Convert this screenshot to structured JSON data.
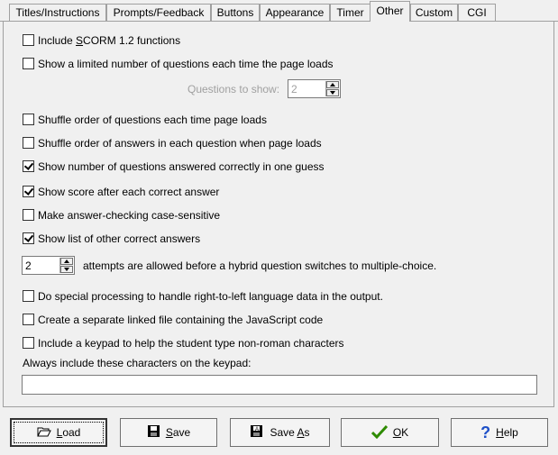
{
  "tabs": [
    {
      "label": "Titles/Instructions",
      "active": false
    },
    {
      "label": "Prompts/Feedback",
      "active": false
    },
    {
      "label": "Buttons",
      "active": false
    },
    {
      "label": "Appearance",
      "active": false
    },
    {
      "label": "Timer",
      "active": false
    },
    {
      "label": "Other",
      "active": true
    },
    {
      "label": "Custom",
      "active": false
    },
    {
      "label": "CGI",
      "active": false
    }
  ],
  "options": {
    "scorm_pre": "Include ",
    "scorm_key": "S",
    "scorm_post": "CORM 1.2 functions",
    "scorm_checked": false,
    "limited": "Show a limited number of questions each time the page loads",
    "limited_checked": false,
    "questions_to_show_label": "Questions to show:",
    "questions_to_show_value": "2",
    "shuffle_questions": "Shuffle order of questions each time page loads",
    "shuffle_questions_checked": false,
    "shuffle_answers": "Shuffle order of answers in each question when page loads",
    "shuffle_answers_checked": false,
    "show_one_guess": "Show number of questions answered correctly in one guess",
    "show_one_guess_checked": true,
    "show_score": "Show score after each correct answer",
    "show_score_checked": true,
    "case_sensitive": "Make answer-checking case-sensitive",
    "case_sensitive_checked": false,
    "show_other_answers": "Show list of other correct answers",
    "show_other_answers_checked": true,
    "attempts_value": "2",
    "attempts_label": "attempts are allowed before a hybrid question switches to multiple-choice.",
    "rtl": "Do special processing to handle right-to-left language data in the output.",
    "rtl_checked": false,
    "separate_js": "Create a separate linked file containing the JavaScript code",
    "separate_js_checked": false,
    "keypad": "Include a keypad to help the student type non-roman characters",
    "keypad_checked": false,
    "keypad_chars_label": "Always include these characters on the keypad:",
    "keypad_chars_value": ""
  },
  "buttons": {
    "load_key": "L",
    "load_rest": "oad",
    "save_key": "S",
    "save_rest": "ave",
    "saveas_pre": "Save ",
    "saveas_key": "A",
    "saveas_rest": "s",
    "ok_key": "O",
    "ok_rest": "K",
    "help_key": "H",
    "help_rest": "elp"
  },
  "icons": {
    "load": "folder-open-icon",
    "save": "floppy-disk-icon",
    "saveas": "floppy-disk-as-icon",
    "ok": "green-checkmark-icon",
    "help": "blue-question-mark-icon"
  },
  "colors": {
    "ok_check": "#2e8b00",
    "help": "#1e50c8"
  }
}
